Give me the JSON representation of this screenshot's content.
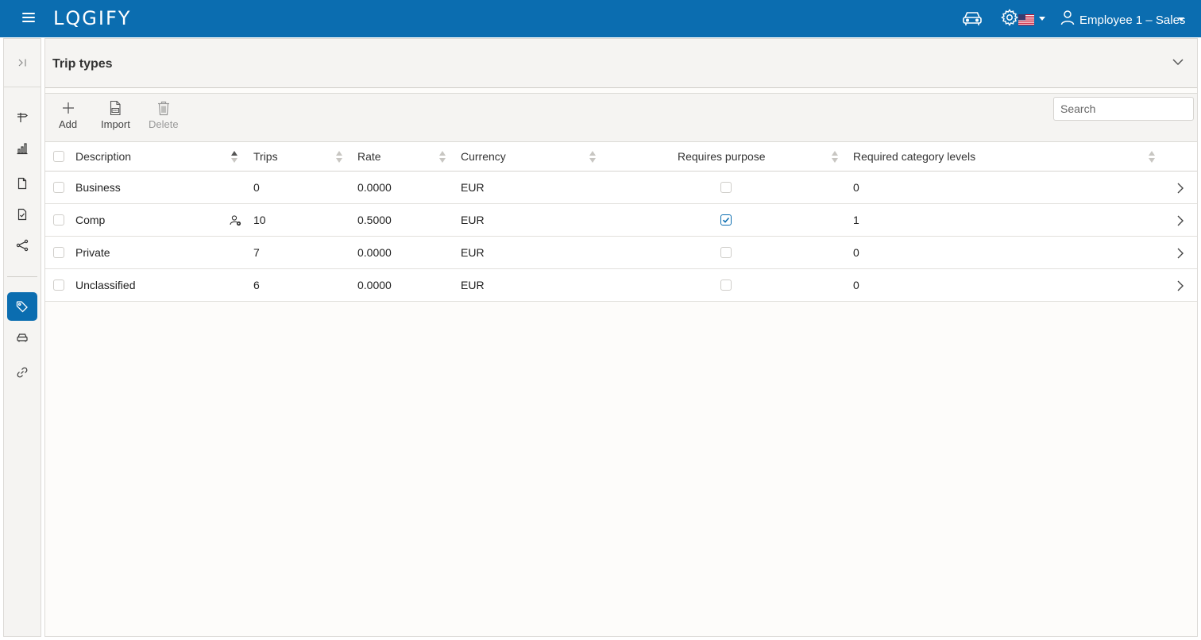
{
  "app": {
    "logo": "LQGIFY",
    "user": "Employee 1 – Sales"
  },
  "icons": {
    "menu": "hamburger-icon",
    "vehicle": "car-icon",
    "settings": "gear-icon",
    "language": "us-flag-icon",
    "user": "user-icon"
  },
  "colors": {
    "brand": "#0b6db0",
    "background": "#fdfcfa",
    "panel": "#f5f4f2"
  },
  "sidebar": {
    "items": [
      {
        "name": "trips",
        "icon": "signpost-icon"
      },
      {
        "name": "reports",
        "icon": "bar-chart-icon"
      },
      {
        "name": "documents",
        "icon": "document-icon"
      },
      {
        "name": "approvals",
        "icon": "document-check-icon"
      },
      {
        "name": "share",
        "icon": "share-icon"
      },
      {
        "name": "trip-types",
        "icon": "tag-icon",
        "active": true
      },
      {
        "name": "vehicles",
        "icon": "car-icon"
      },
      {
        "name": "links",
        "icon": "link-icon"
      }
    ]
  },
  "page": {
    "title": "Trip types"
  },
  "toolbar": {
    "add_label": "Add",
    "import_label": "Import",
    "delete_label": "Delete",
    "search_placeholder": "Search"
  },
  "table": {
    "columns": {
      "description": "Description",
      "trips": "Trips",
      "rate": "Rate",
      "currency": "Currency",
      "requires_purpose": "Requires purpose",
      "required_category_levels": "Required category levels"
    },
    "rows": [
      {
        "description": "Business",
        "trips": "0",
        "rate": "0.0000",
        "currency": "EUR",
        "requires_purpose": false,
        "required_category_levels": "0",
        "has_user_badge": false
      },
      {
        "description": "Comp",
        "trips": "10",
        "rate": "0.5000",
        "currency": "EUR",
        "requires_purpose": true,
        "required_category_levels": "1",
        "has_user_badge": true
      },
      {
        "description": "Private",
        "trips": "7",
        "rate": "0.0000",
        "currency": "EUR",
        "requires_purpose": false,
        "required_category_levels": "0",
        "has_user_badge": false
      },
      {
        "description": "Unclassified",
        "trips": "6",
        "rate": "0.0000",
        "currency": "EUR",
        "requires_purpose": false,
        "required_category_levels": "0",
        "has_user_badge": false
      }
    ]
  }
}
